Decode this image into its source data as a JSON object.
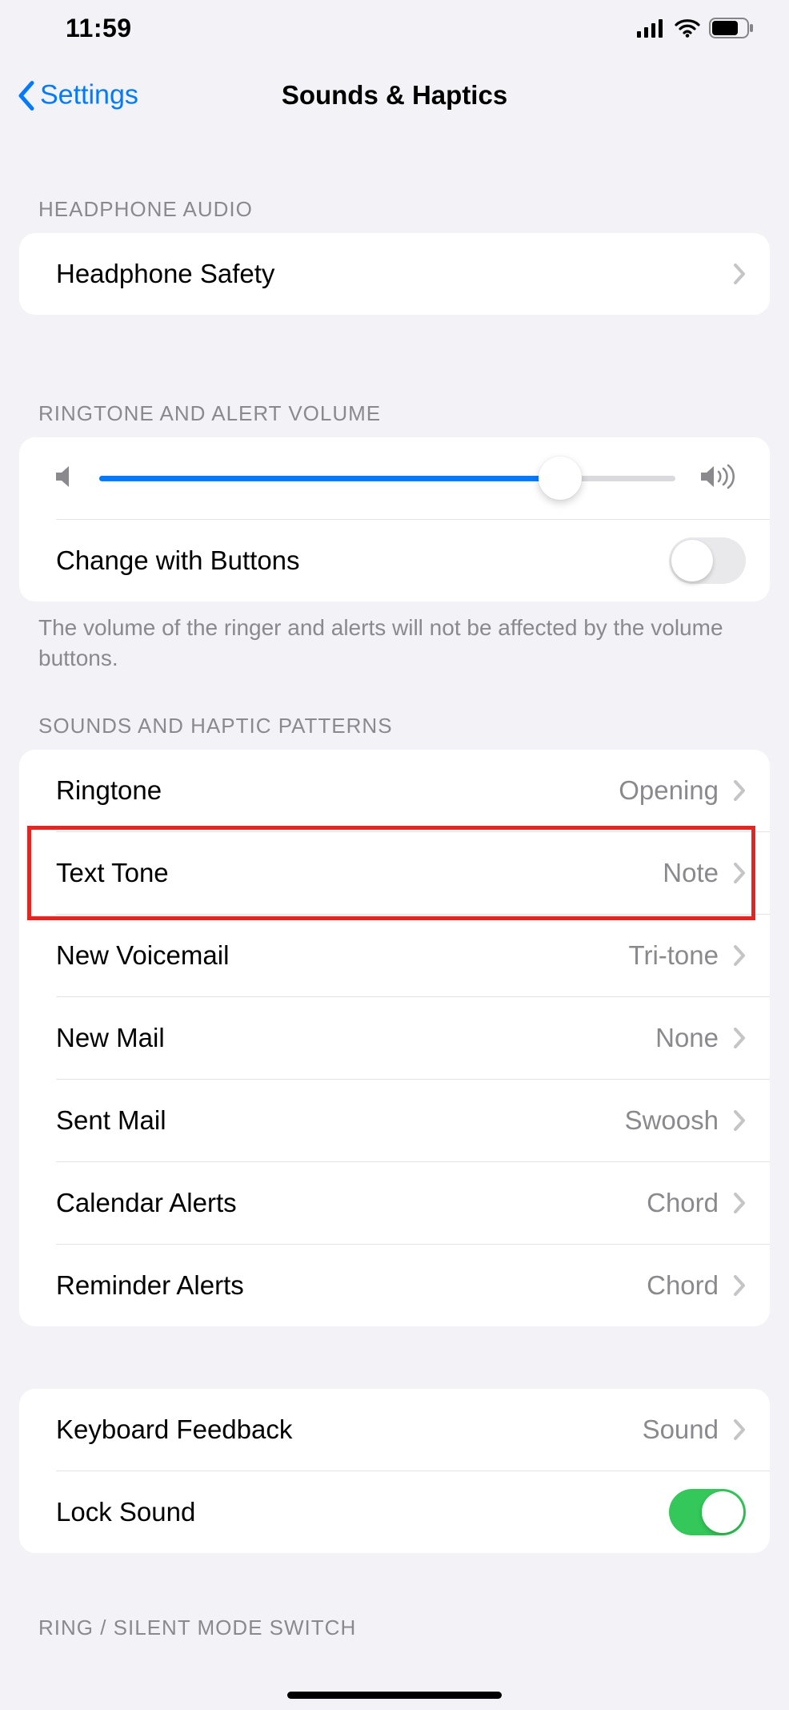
{
  "statusbar": {
    "time": "11:59"
  },
  "nav": {
    "back_label": "Settings",
    "title": "Sounds & Haptics"
  },
  "sections": {
    "headphone": {
      "header": "HEADPHONE AUDIO",
      "safety_label": "Headphone Safety"
    },
    "volume": {
      "header": "RINGTONE AND ALERT VOLUME",
      "slider_percent": 80,
      "change_buttons_label": "Change with Buttons",
      "change_buttons_on": false,
      "footer": "The volume of the ringer and alerts will not be affected by the volume buttons."
    },
    "patterns": {
      "header": "SOUNDS AND HAPTIC PATTERNS",
      "items": [
        {
          "label": "Ringtone",
          "value": "Opening",
          "highlight": false
        },
        {
          "label": "Text Tone",
          "value": "Note",
          "highlight": true
        },
        {
          "label": "New Voicemail",
          "value": "Tri-tone",
          "highlight": false
        },
        {
          "label": "New Mail",
          "value": "None",
          "highlight": false
        },
        {
          "label": "Sent Mail",
          "value": "Swoosh",
          "highlight": false
        },
        {
          "label": "Calendar Alerts",
          "value": "Chord",
          "highlight": false
        },
        {
          "label": "Reminder Alerts",
          "value": "Chord",
          "highlight": false
        }
      ]
    },
    "feedback": {
      "keyboard_label": "Keyboard Feedback",
      "keyboard_value": "Sound",
      "lock_sound_label": "Lock Sound",
      "lock_sound_on": true
    },
    "ring_switch": {
      "header": "RING / SILENT MODE SWITCH"
    }
  }
}
